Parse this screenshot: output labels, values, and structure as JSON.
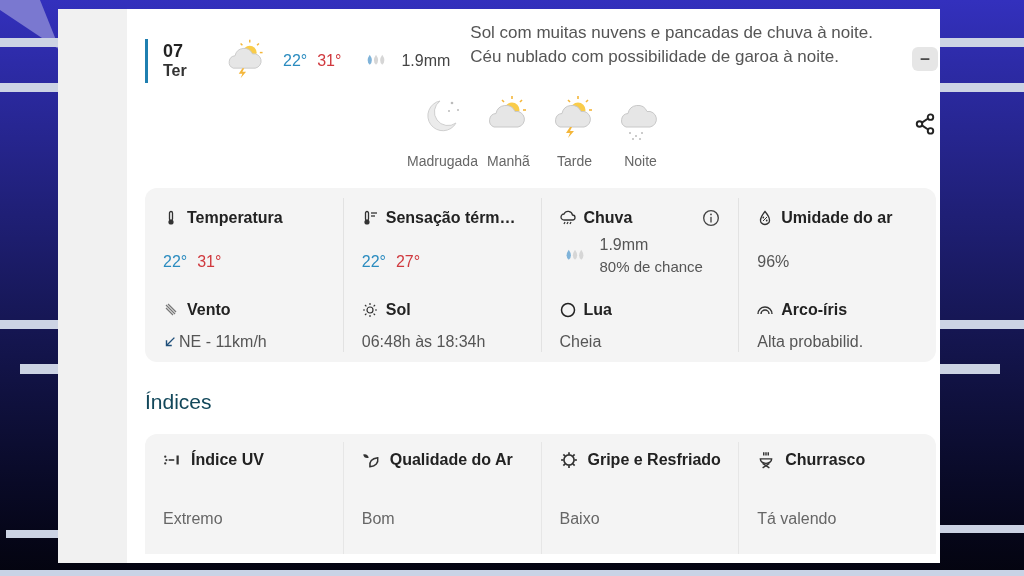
{
  "day": {
    "date": "07",
    "weekday": "Ter",
    "min": "22°",
    "max": "31°",
    "rain": "1.9mm",
    "description": "Sol com muitas nuvens e pancadas de chuva à noite. Céu nublado com possibilidade de garoa à noite.",
    "expanded": true
  },
  "periods": [
    {
      "label": "Madrugada",
      "kind": "moon"
    },
    {
      "label": "Manhã",
      "kind": "sun-cloud"
    },
    {
      "label": "Tarde",
      "kind": "storm"
    },
    {
      "label": "Noite",
      "kind": "rain"
    }
  ],
  "details": [
    {
      "kind": "temp",
      "label": "Temperatura",
      "min": "22°",
      "max": "31°"
    },
    {
      "kind": "temp",
      "label": "Sensação térm…",
      "min": "22°",
      "max": "27°"
    },
    {
      "kind": "rain",
      "label": "Chuva",
      "amount": "1.9mm",
      "chance": "80% de chance"
    },
    {
      "kind": "text",
      "label": "Umidade do ar",
      "value": "96%"
    },
    {
      "kind": "wind",
      "label": "Vento",
      "value": "NE - 11km/h"
    },
    {
      "kind": "text",
      "label": "Sol",
      "value": "06:48h às 18:34h"
    },
    {
      "kind": "text",
      "label": "Lua",
      "value": "Cheia"
    },
    {
      "kind": "text",
      "label": "Arco-íris",
      "value": "Alta probabilid."
    }
  ],
  "indices_title": "Índices",
  "indices": [
    {
      "label": "Índice UV",
      "value": "Extremo"
    },
    {
      "label": "Qualidade do Ar",
      "value": "Bom"
    },
    {
      "label": "Gripe e Resfriado",
      "value": "Baixo"
    },
    {
      "label": "Churrasco",
      "value": "Tá valendo"
    }
  ]
}
